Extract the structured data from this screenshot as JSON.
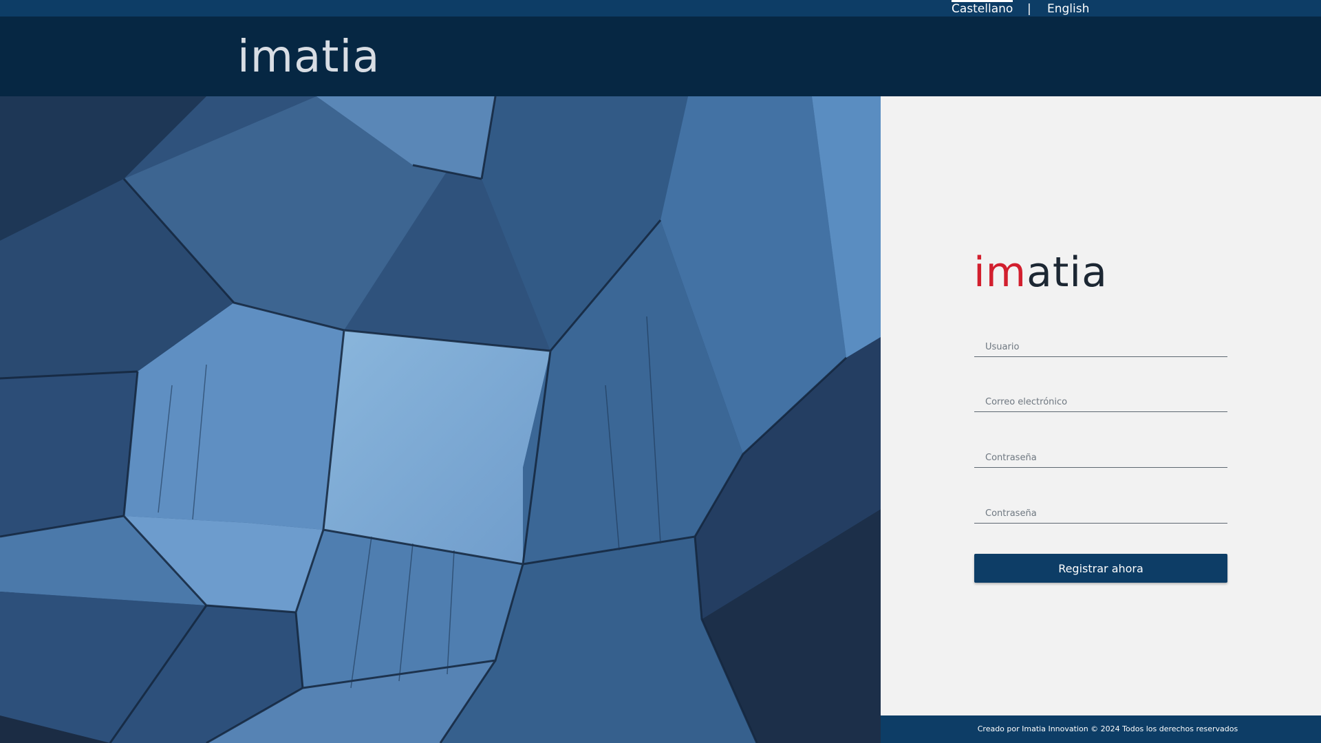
{
  "languages": {
    "spanish": "Castellano",
    "separator": "|",
    "english": "English"
  },
  "header": {
    "logo_text": "imatia"
  },
  "form": {
    "logo": {
      "part1": "im",
      "part2": "atia"
    },
    "username_placeholder": "Usuario",
    "email_placeholder": "Correo electrónico",
    "password_placeholder": "Contraseña",
    "password_confirm_placeholder": "Contraseña",
    "submit_label": "Registrar ahora"
  },
  "footer": {
    "text": "Creado por Imatia Innovation © 2024 Todos los derechos reservados"
  },
  "colors": {
    "lang_bar": "#0d3d66",
    "header": "#062743",
    "brand_red": "#d21f2e",
    "brand_dark": "#1c2733",
    "button": "#0d3d66",
    "panel_bg": "#f2f2f2"
  }
}
